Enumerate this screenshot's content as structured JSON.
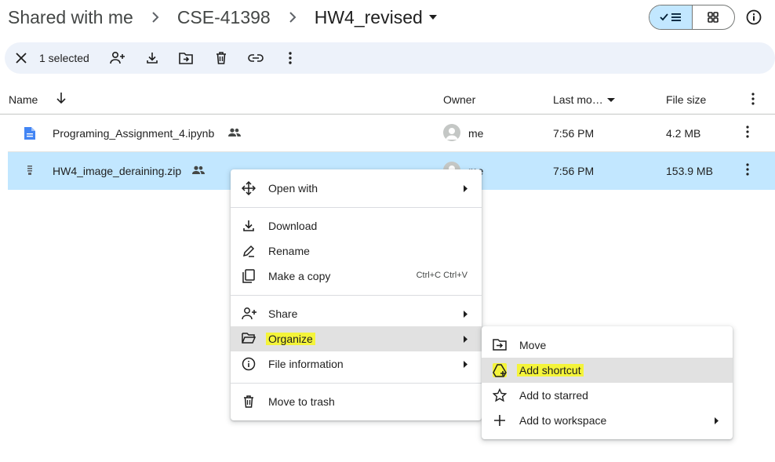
{
  "breadcrumb": {
    "root": "Shared with me",
    "folder": "CSE-41398",
    "current": "HW4_revised"
  },
  "toolbar": {
    "selection_count": "1 selected"
  },
  "table": {
    "columns": {
      "name": "Name",
      "owner": "Owner",
      "modified": "Last mo…",
      "size": "File size"
    },
    "rows": [
      {
        "name": "Programing_Assignment_4.ipynb",
        "owner": "me",
        "modified": "7:56 PM",
        "size": "4.2 MB",
        "icon": "document-icon"
      },
      {
        "name": "HW4_image_deraining.zip",
        "owner": "me",
        "modified": "7:56 PM",
        "size": "153.9 MB",
        "icon": "zip-icon"
      }
    ]
  },
  "context_menu": {
    "items": [
      {
        "label": "Open with",
        "icon": "open-with-icon"
      },
      {
        "label": "Download",
        "icon": "download-icon"
      },
      {
        "label": "Rename",
        "icon": "rename-icon"
      },
      {
        "label": "Make a copy",
        "icon": "copy-icon",
        "shortcut": "Ctrl+C Ctrl+V"
      },
      {
        "label": "Share",
        "icon": "share-icon"
      },
      {
        "label": "Organize",
        "icon": "folder-open-icon"
      },
      {
        "label": "File information",
        "icon": "info-icon"
      },
      {
        "label": "Move to trash",
        "icon": "trash-icon"
      }
    ]
  },
  "organize_submenu": {
    "items": [
      {
        "label": "Move",
        "icon": "move-icon"
      },
      {
        "label": "Add shortcut",
        "icon": "add-shortcut-icon"
      },
      {
        "label": "Add to starred",
        "icon": "star-icon"
      },
      {
        "label": "Add to workspace",
        "icon": "plus-icon"
      }
    ]
  },
  "colors": {
    "selected_row": "#c2e7ff",
    "toolbar_bg": "#edf2fa",
    "highlight": "#f4f43a",
    "hover": "#e1e1e1"
  }
}
